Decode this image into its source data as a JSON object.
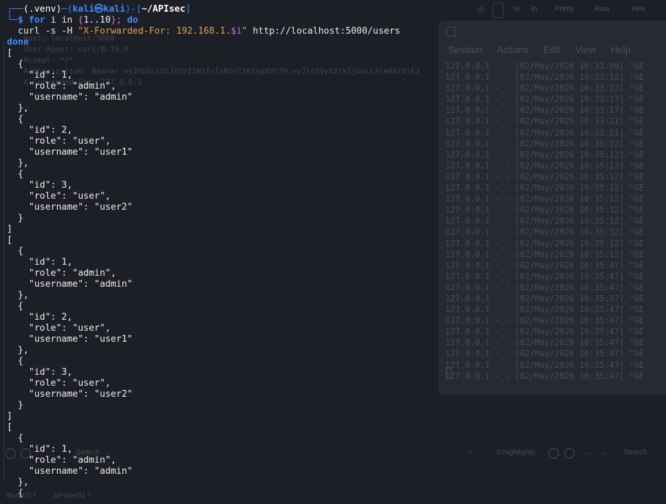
{
  "background_windows": {
    "toolbar": {
      "pretty_label": "Pretty",
      "raw_label": "Raw",
      "hex_label": "Hex",
      "ln_label": "\\n",
      "ln2_label": "ln"
    },
    "request_ghost": [
      "Host: localhost:5000",
      "User-Agent: curl/8.19.0",
      "Accept: */*",
      "Authorization: Bearer eyJhbGciOiJIUzI1NiIsInR5cCI6IkpXVCJ9.eyJlc2VyX2lkIjoxLCJleHAiOjE3",
      "X-Forwarded-For: 127.0.0.1"
    ],
    "log_window": {
      "menu": [
        "Session",
        "Actions",
        "Edit",
        "View",
        "Help"
      ],
      "log_lines": [
        "127.0.0.1 - - [02/May/2026 10:33:09] \"GE",
        "127.0.0.1 - - [02/May/2026 10:33:12] \"GE",
        "127.0.0.1 - - [02/May/2026 10:33:12] \"GE",
        "127.0.0.1 - - [02/May/2026 10:33:17] \"GE",
        "127.0.0.1 - - [02/May/2026 10:33:17] \"GE",
        "127.0.0.1 - - [02/May/2026 10:33:21] \"GE",
        "127.0.0.1 - - [02/May/2026 10:33:21] \"GE",
        "127.0.0.1 - - [02/May/2026 10:35:12] \"GE",
        "127.0.0.1 - - [02/May/2026 10:35:12] \"GE",
        "127.0.0.1 - - [02/May/2026 10:35:12] \"GE",
        "127.0.0.1 - - [02/May/2026 10:35:12] \"GE",
        "127.0.0.1 - - [02/May/2026 10:35:12] \"GE",
        "127.0.0.1 - - [02/May/2026 10:35:12] \"GE",
        "127.0.0.1 - - [02/May/2026 10:35:12] \"GE",
        "127.0.0.1 - - [02/May/2026 10:35:12] \"GE",
        "127.0.0.1 - - [02/May/2026 10:35:12] \"GE",
        "127.0.0.1 - - [02/May/2026 10:35:12] \"GE",
        "127.0.0.1 - - [02/May/2026 10:35:12] \"GE",
        "127.0.0.1 - - [02/May/2026 10:35:47] \"GE",
        "127.0.0.1 - - [02/May/2026 10:35:47] \"GE",
        "127.0.0.1 - - [02/May/2026 10:35:47] \"GE",
        "127.0.0.1 - - [02/May/2026 10:35:47] \"GE",
        "127.0.0.1 - - [02/May/2026 10:35:47] \"GE",
        "127.0.0.1 - - [02/May/2026 10:35:47] \"GE",
        "127.0.0.1 - - [02/May/2026 10:35:47] \"GE",
        "127.0.0.1 - - [02/May/2026 10:35:47] \"GE",
        "127.0.0.1 - - [02/May/2026 10:35:47] \"GE",
        "127.0.0.1 - - [02/May/2026 10:35:47] \"GE",
        "127.0.0.1 - - [02/May/2026 10:35:47] \"GE"
      ]
    },
    "findbar": {
      "search_left": "Search",
      "highlights": "0 highlights",
      "search_right": "Search"
    },
    "tabs": [
      "Burp01 *",
      "APIsec01 *"
    ]
  },
  "terminal": {
    "prompt": {
      "box_top": "┌──",
      "venv": "(.venv)",
      "dash1": "─",
      "open_paren": "(",
      "user": "kali",
      "at": "㉿",
      "host": "kali",
      "close_paren": ")",
      "dash2": "-",
      "open_bracket": "[",
      "cwd": "~/APIsec",
      "close_bracket": "]",
      "box_bottom": "└─",
      "dollar": "$"
    },
    "cmd": {
      "for_kw": "for",
      "var": " i ",
      "in_kw": "in",
      "brace_open": " {",
      "range": "1..10",
      "brace_close": "};",
      "do_kw": " do",
      "curl_line_indent": "  ",
      "curl": "curl",
      "flags": " -s -H ",
      "header_str_a": "\"X-Forwarded-For: 192.168.1.",
      "header_var": "$i",
      "header_str_b": "\"",
      "url": " http://localhost:5000/users",
      "done_kw": "done"
    },
    "output_lines": [
      "[",
      "  {",
      "    \"id\": 1,",
      "    \"role\": \"admin\",",
      "    \"username\": \"admin\"",
      "  },",
      "  {",
      "    \"id\": 2,",
      "    \"role\": \"user\",",
      "    \"username\": \"user1\"",
      "  },",
      "  {",
      "    \"id\": 3,",
      "    \"role\": \"user\",",
      "    \"username\": \"user2\"",
      "  }",
      "]",
      "[",
      "  {",
      "    \"id\": 1,",
      "    \"role\": \"admin\",",
      "    \"username\": \"admin\"",
      "  },",
      "  {",
      "    \"id\": 2,",
      "    \"role\": \"user\",",
      "    \"username\": \"user1\"",
      "  },",
      "  {",
      "    \"id\": 3,",
      "    \"role\": \"user\",",
      "    \"username\": \"user2\"",
      "  }",
      "]",
      "[",
      "  {",
      "    \"id\": 1,",
      "    \"role\": \"admin\",",
      "    \"username\": \"admin\"",
      "  },",
      "  {"
    ]
  }
}
